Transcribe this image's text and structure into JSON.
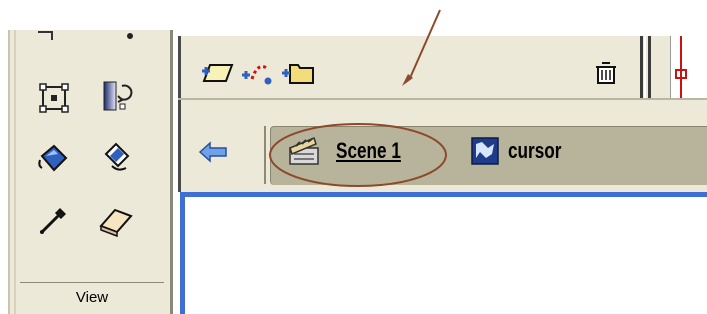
{
  "tools_panel": {
    "tools": [
      {
        "name": "free-transform-tool",
        "icon": "free-transform-icon"
      },
      {
        "name": "fill-transform-tool",
        "icon": "fill-transform-icon"
      },
      {
        "name": "ink-bottle-tool",
        "icon": "ink-bottle-icon"
      },
      {
        "name": "paint-bucket-tool",
        "icon": "paint-bucket-icon"
      },
      {
        "name": "eyedropper-tool",
        "icon": "eyedropper-icon"
      },
      {
        "name": "eraser-tool",
        "icon": "eraser-icon"
      }
    ],
    "section_label": "View"
  },
  "timeline_toolbar": {
    "buttons": [
      "add-layer-icon",
      "add-motion-guide-icon",
      "add-layer-folder-icon",
      "delete-layer-icon"
    ]
  },
  "scene_bar": {
    "back_icon": "back-arrow-icon",
    "breadcrumbs": [
      {
        "label": "Scene 1",
        "icon": "clapperboard-icon"
      },
      {
        "label": "cursor",
        "icon": "movie-clip-icon"
      }
    ]
  },
  "colors": {
    "panel_bg": "#ece9d8",
    "scene_strip": "#b8b39b",
    "stage_border": "#3d6fd4",
    "annotation": "#8b4a2b"
  }
}
